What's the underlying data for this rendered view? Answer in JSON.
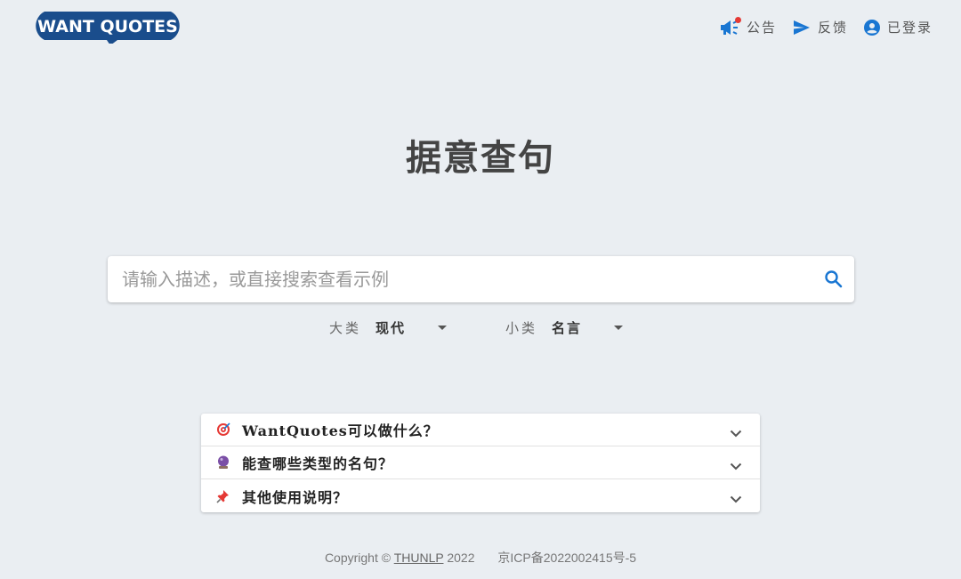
{
  "logo": {
    "text": "WANT QUOTES"
  },
  "topnav": {
    "announcement": {
      "label": "公告",
      "icon": "megaphone-icon"
    },
    "feedback": {
      "label": "反馈",
      "icon": "send-icon"
    },
    "account": {
      "label": "已登录",
      "icon": "account-circle-icon"
    }
  },
  "title": "据意查句",
  "search": {
    "placeholder": "请输入描述，或直接搜索查看示例",
    "value": "",
    "icon": "search-icon"
  },
  "filters": {
    "category": {
      "label": "大类",
      "value": "现代"
    },
    "subcategory": {
      "label": "小类",
      "value": "名言"
    }
  },
  "faq": [
    {
      "icon": "target-emoji-icon",
      "emoji": "🎯",
      "text": "WantQuotes可以做什么？"
    },
    {
      "icon": "crystal-ball-emoji-icon",
      "emoji": "🔮",
      "text": "能查哪些类型的名句？"
    },
    {
      "icon": "pushpin-emoji-icon",
      "emoji": "📌",
      "text": "其他使用说明？"
    }
  ],
  "footer": {
    "copyright_prefix": "Copyright © ",
    "org_link": "THUNLP",
    "year": " 2022",
    "icp": "京ICP备2022002415号-5"
  },
  "colors": {
    "accent": "#1976d2",
    "logo_bg": "#1a4d8c",
    "logo_accent": "#f5a623",
    "background": "#eaeef2",
    "notification_dot": "#e53935"
  }
}
